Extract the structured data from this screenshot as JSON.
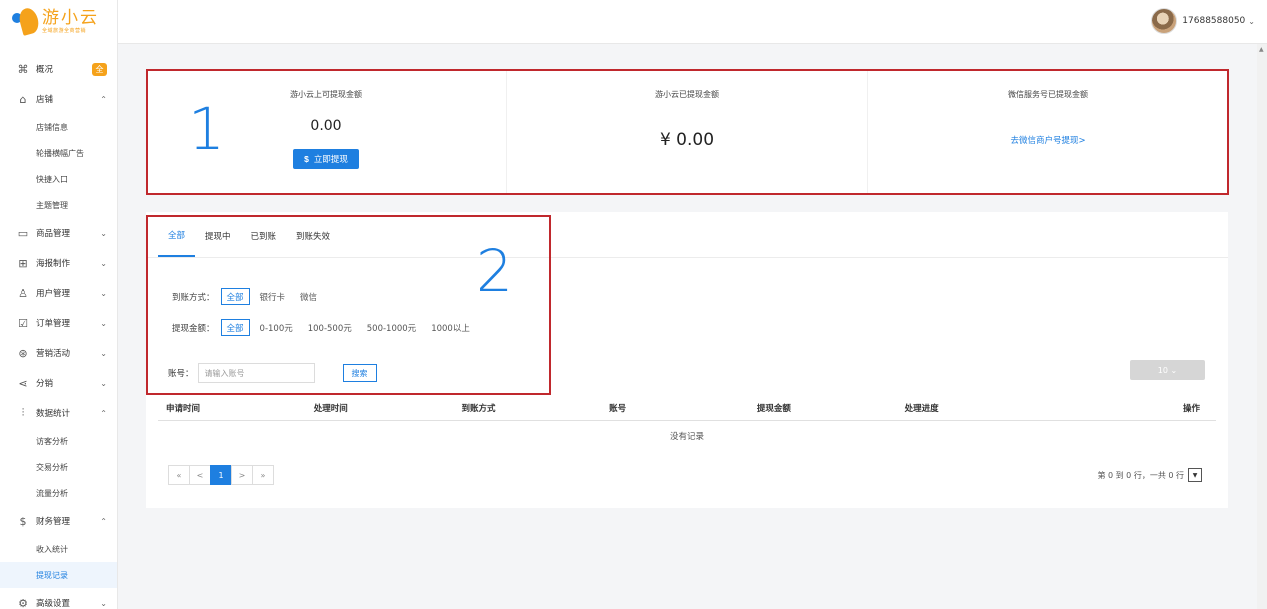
{
  "logo": {
    "title": "游小云",
    "subtitle": "全域旅游全商营销"
  },
  "sidebar": {
    "items": [
      {
        "icon": "command-icon",
        "glyph": "⌘",
        "label": "概况",
        "badge": "全"
      },
      {
        "icon": "home-icon",
        "glyph": "⌂",
        "label": "店铺",
        "chevron": "⌃",
        "children": [
          "店铺信息",
          "轮播横幅广告",
          "快捷入口",
          "主题管理"
        ]
      },
      {
        "icon": "calendar-icon",
        "glyph": "▭",
        "label": "商品管理",
        "chevron": "⌄"
      },
      {
        "icon": "map-icon",
        "glyph": "⊞",
        "label": "海报制作",
        "chevron": "⌄"
      },
      {
        "icon": "users-icon",
        "glyph": "♙",
        "label": "用户管理",
        "chevron": "⌄"
      },
      {
        "icon": "order-check-icon",
        "glyph": "☑",
        "label": "订单管理",
        "chevron": "⌄"
      },
      {
        "icon": "marketing-icon",
        "glyph": "⊛",
        "label": "营销活动",
        "chevron": "⌄"
      },
      {
        "icon": "share-icon",
        "glyph": "⋖",
        "label": "分销",
        "chevron": "⌄"
      },
      {
        "icon": "bar-chart-icon",
        "glyph": "⫶",
        "label": "数据统计",
        "chevron": "⌃",
        "children": [
          "访客分析",
          "交易分析",
          "流量分析"
        ]
      },
      {
        "icon": "dollar-icon",
        "glyph": "$",
        "label": "财务管理",
        "chevron": "⌃",
        "children": [
          "收入统计",
          "提现记录"
        ]
      },
      {
        "icon": "settings-icon",
        "glyph": "⚙",
        "label": "高级设置",
        "chevron": "⌄"
      }
    ],
    "active_child": "提现记录"
  },
  "header": {
    "username": "17688588050",
    "chevron": "⌄"
  },
  "summary": {
    "cards": [
      {
        "title": "游小云上可提现金额",
        "amount": "0.00",
        "button": "立即提现",
        "button_icon": "$"
      },
      {
        "title": "游小云已提现金额",
        "amount": "¥ 0.00"
      },
      {
        "title": "微信服务号已提现金额",
        "link": "去微信商户号提现>"
      }
    ],
    "annotation": "1"
  },
  "records": {
    "annotation": "2",
    "tabs": [
      "全部",
      "提现中",
      "已到账",
      "到账失效"
    ],
    "active_tab": 0,
    "method_filter": {
      "label": "到账方式：",
      "options": [
        "全部",
        "银行卡",
        "微信"
      ],
      "active": 0
    },
    "amount_filter": {
      "label": "提现金额：",
      "options": [
        "全部",
        "0-100元",
        "100-500元",
        "500-1000元",
        "1000以上"
      ],
      "active": 0
    },
    "account": {
      "label": "账号：",
      "placeholder": "请输入账号",
      "value": "",
      "search_label": "搜索"
    },
    "page_size": {
      "value": "10",
      "chevron": "⌄"
    },
    "columns": [
      "申请时间",
      "处理时间",
      "到账方式",
      "账号",
      "提现金额",
      "处理进度",
      "操作"
    ],
    "empty_text": "没有记录",
    "pager": [
      "«",
      "<",
      "1",
      ">",
      "»"
    ],
    "pager_active": 2,
    "page_info": "第 0 到 0 行，一共 0 行",
    "page_info_dropdown": "▼"
  },
  "colors": {
    "accent": "#1e7fe0",
    "brand": "#f5a21b",
    "annotation_box": "#c0282d"
  }
}
